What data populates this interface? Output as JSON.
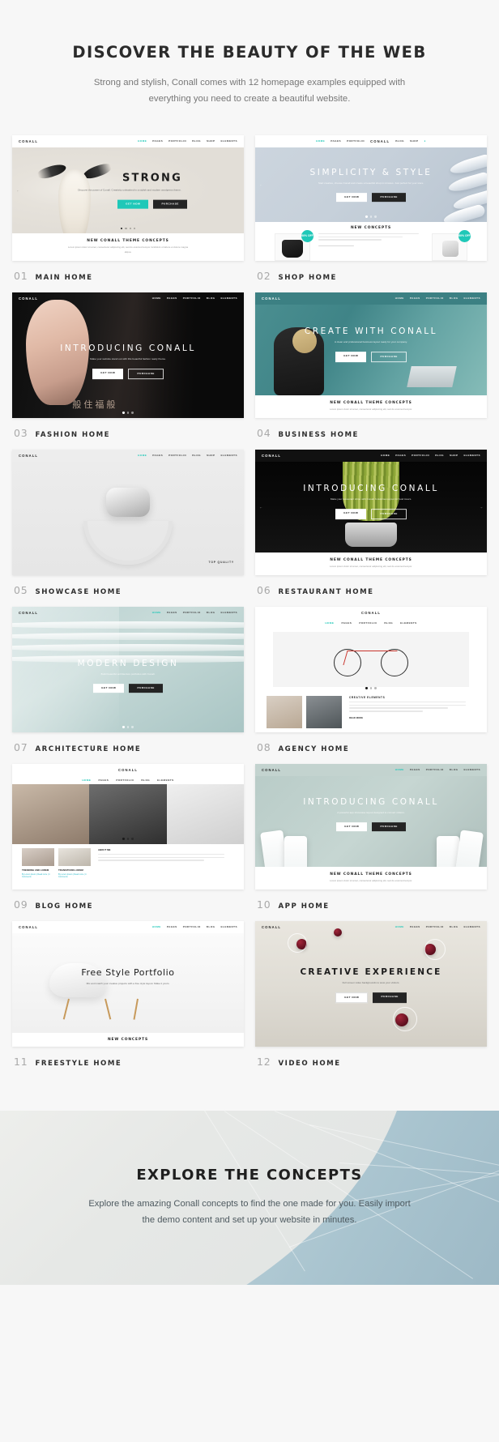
{
  "intro": {
    "title": "DISCOVER THE BEAUTY OF THE WEB",
    "subtitle": "Strong and stylish, Conall comes with 12 homepage examples equipped with everything you need to create a beautiful website."
  },
  "brand": {
    "name": "CONALL",
    "accent": "#1fc8b8",
    "dark": "#242424",
    "page_bg": "#f7f7f7"
  },
  "common": {
    "nav_items": [
      "HOME",
      "PAGES",
      "PORTFOLIO",
      "BLOG",
      "SHOP",
      "ELEMENTS"
    ],
    "nav_active": "HOME",
    "footer_heading": "NEW CONALL THEME CONCEPTS",
    "footer_text": "Lorem ipsum dolor sit amet, consectetur adipiscing elit, sed do eiusmod tempor incididunt ut labore et dolore magna aliqua enim ad minim.",
    "btn_primary": "GET NOW",
    "btn_secondary": "PURCHASE",
    "hero_paragraph": "Discover the power of Conall. Creativity unleashed in a stylish and modern wordpress theme."
  },
  "thumbnails": [
    {
      "num": "01",
      "label": "MAIN HOME",
      "hero_title": "STRONG",
      "hero_paragraph": "Discover the power of Conall. Creativity unleashed in a stylish and modern wordpress theme.",
      "btn_primary": "GET NOW",
      "btn_secondary": "PURCHASE",
      "footer_heading": "NEW CONALL THEME CONCEPTS",
      "footer_text": "Lorem ipsum dolor sit amet, consectetur adipiscing elit, sed do eiusmod tempor incididunt ut labore et dolore magna aliqua.",
      "scene": "strong"
    },
    {
      "num": "02",
      "label": "SHOP HOME",
      "hero_title": "SIMPLICITY & STYLE",
      "hero_paragraph": "Start creative, choose Conall and create a beautiful shop in minutes. Just perfect for your store.",
      "btn_primary": "GET NOW",
      "btn_secondary": "PURCHASE",
      "footer_heading": "NEW CONCEPTS",
      "footer_text": "Lorem ipsum dolor sit amet consectetur adipiscing.",
      "badge_text": "60% OFF",
      "scene": "shop"
    },
    {
      "num": "03",
      "label": "FASHION HOME",
      "hero_title": "INTRODUCING CONALL",
      "hero_paragraph": "Make your website stand out with this beautiful fashion ready theme.",
      "btn_primary": "GET NOW",
      "btn_secondary": "PURCHASE",
      "scene": "fashion"
    },
    {
      "num": "04",
      "label": "BUSINESS HOME",
      "hero_title": "CREATE WITH CONALL",
      "hero_paragraph": "A clean and professional business layout ready for your company.",
      "btn_primary": "GET NOW",
      "btn_secondary": "PURCHASE",
      "footer_heading": "NEW CONALL THEME CONCEPTS",
      "footer_text": "Lorem ipsum dolor sit amet, consectetur adipiscing elit, sed do eiusmod tempor.",
      "scene": "business"
    },
    {
      "num": "05",
      "label": "SHOWCASE HOME",
      "hero_title": "",
      "corner_text": "TOP QUALITY",
      "scene": "showcase"
    },
    {
      "num": "06",
      "label": "RESTAURANT HOME",
      "hero_title": "INTRODUCING CONALL",
      "hero_paragraph": "Make your restaurant shine with Conall. A delicious layout for food lovers.",
      "btn_primary": "GET NOW",
      "btn_secondary": "PURCHASE",
      "footer_heading": "NEW CONALL THEME CONCEPTS",
      "footer_text": "Lorem ipsum dolor sit amet, consectetur adipiscing elit, sed do eiusmod tempor.",
      "scene": "restaurant"
    },
    {
      "num": "07",
      "label": "ARCHITECTURE HOME",
      "hero_title": "MODERN DESIGN",
      "hero_paragraph": "Build beautiful architecture portfolios with Conall.",
      "btn_primary": "GET NOW",
      "btn_secondary": "PURCHASE",
      "scene": "architecture"
    },
    {
      "num": "08",
      "label": "AGENCY HOME",
      "hero_title": "",
      "section_heading": "CREATIVE ELEMENTS",
      "section_text": "Lorem ipsum dolor sit amet, consectetur adipiscing elit, sed do eiusmod tempor incididunt.",
      "btn_primary": "READ MORE",
      "scene": "agency"
    },
    {
      "num": "09",
      "label": "BLOG HOME",
      "post_titles": [
        "TRENDING AND LOREM",
        "TRANSITIONS LOREM"
      ],
      "post_meta": "By Lorem Ipsum  |  Read more  |  4 Comments",
      "sidebar_heading": "ABOUT ME",
      "scene": "blog"
    },
    {
      "num": "10",
      "label": "APP HOME",
      "hero_title": "INTRODUCING CONALL",
      "hero_paragraph": "A powerful app showcase layout designed to convert visitors.",
      "btn_primary": "GET NOW",
      "btn_secondary": "PURCHASE",
      "footer_heading": "NEW CONALL THEME CONCEPTS",
      "footer_text": "Lorem ipsum dolor sit amet, consectetur adipiscing elit, sed do eiusmod tempor.",
      "scene": "app"
    },
    {
      "num": "11",
      "label": "FREESTYLE HOME",
      "hero_title": "Free Style Portfolio",
      "hero_paragraph": "Mix and match your creative projects with a free style layout. Make it yours.",
      "footer_heading": "NEW CONCEPTS",
      "scene": "freestyle"
    },
    {
      "num": "12",
      "label": "VIDEO HOME",
      "hero_title": "CREATIVE EXPERIENCE",
      "hero_paragraph": "Full screen video backgrounds to wow your visitors.",
      "btn_primary": "GET NOW",
      "btn_secondary": "PURCHASE",
      "scene": "video"
    }
  ],
  "explore": {
    "title": "EXPLORE THE CONCEPTS",
    "subtitle": "Explore the amazing Conall concepts to find the one made for you. Easily import the demo content and set up your website in minutes."
  }
}
